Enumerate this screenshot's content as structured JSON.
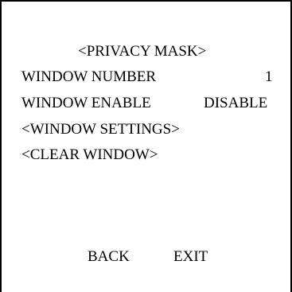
{
  "menu": {
    "title": "<PRIVACY MASK>",
    "window_number_label": "WINDOW NUMBER",
    "window_number_value": "1",
    "window_enable_label": "WINDOW ENABLE",
    "window_enable_value": "DISABLE",
    "window_settings_label": "<WINDOW SETTINGS>",
    "clear_window_label": "<CLEAR WINDOW>"
  },
  "footer": {
    "back_label": "BACK",
    "exit_label": "EXIT"
  }
}
